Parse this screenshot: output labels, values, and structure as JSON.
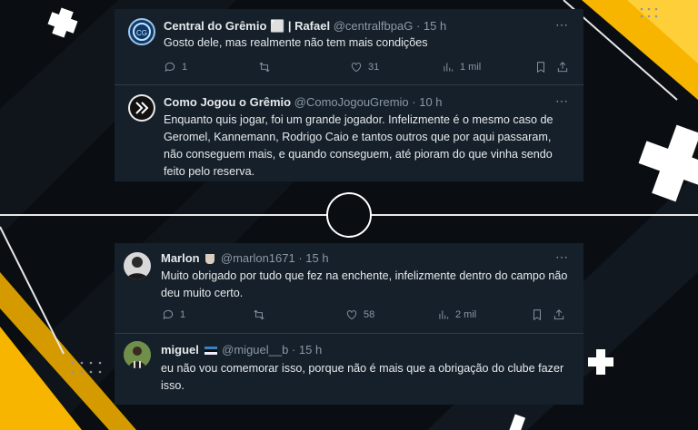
{
  "colors": {
    "card_bg": "#15202b",
    "accent_yellow": "#f7b500",
    "text": "#e7e9ea",
    "muted": "#8b98a5"
  },
  "top_thread": {
    "tweets": [
      {
        "name": "Central do Grêmio ⬜ | Rafael",
        "handle": "@centralfbpaG · 15 h",
        "text": "Gosto dele, mas realmente não tem mais condições",
        "replies": "1",
        "retweets": "",
        "likes": "31",
        "views": "1 mil"
      },
      {
        "name": "Como Jogou o Grêmio",
        "handle": "@ComoJogouGremio · 10 h",
        "text": "Enquanto quis jogar, foi um grande jogador. Infelizmente é o mesmo caso de Geromel, Kannemann, Rodrigo Caio e tantos outros que por aqui passaram, não conseguem mais, e quando conseguem, até pioram do que vinha sendo feito pelo reserva."
      }
    ]
  },
  "bottom_thread": {
    "tweets": [
      {
        "name": "Marlon",
        "handle": "@marlon1671 · 15 h",
        "text": "Muito obrigado por tudo que fez na enchente, infelizmente dentro do campo não deu muito certo.",
        "replies": "1",
        "retweets": "",
        "likes": "58",
        "views": "2 mil"
      },
      {
        "name": "miguel",
        "handle": "@miguel__b · 15 h",
        "text": "eu não vou comemorar isso, porque não é mais que a obrigação do clube fazer isso."
      }
    ]
  },
  "more_icon": "⋯"
}
